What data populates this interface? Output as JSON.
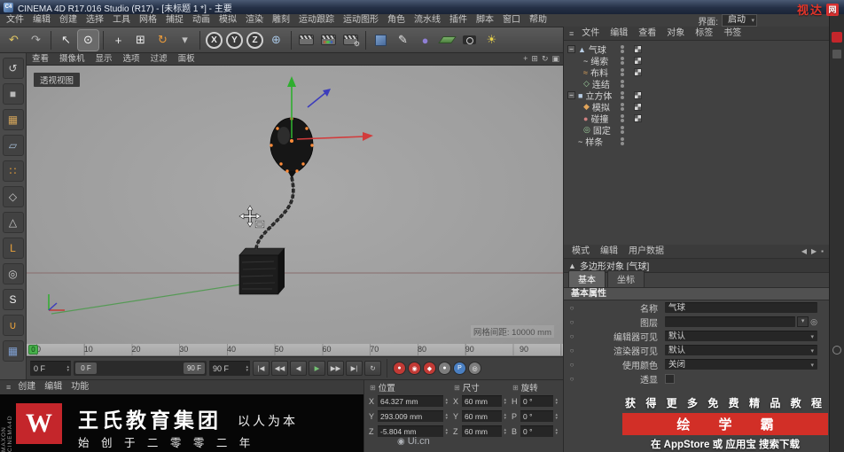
{
  "window": {
    "title": "CINEMA 4D R17.016 Studio (R17) - [未标题 1 *] - 主要",
    "app_badge": "C4",
    "brand": "视达",
    "brand_badge": "网"
  },
  "menubar": {
    "items": [
      "文件",
      "编辑",
      "创建",
      "选择",
      "工具",
      "网格",
      "捕捉",
      "动画",
      "模拟",
      "渲染",
      "雕刻",
      "运动跟踪",
      "运动图形",
      "角色",
      "流水线",
      "插件",
      "脚本",
      "窗口",
      "帮助"
    ],
    "interface_label": "界面:",
    "interface_value": "启动"
  },
  "toolbar": {
    "tools": [
      {
        "name": "undo-icon",
        "glyph": "↶",
        "color": "#dec564"
      },
      {
        "name": "redo-icon",
        "glyph": "↷",
        "color": "#b5b5b5"
      },
      {
        "name": "separator"
      },
      {
        "name": "select-tool-icon",
        "glyph": "↖",
        "color": "#e8e8e8"
      },
      {
        "name": "live-selection-icon",
        "glyph": "⊙",
        "color": "#f2f2f2",
        "active": true
      },
      {
        "name": "separator"
      },
      {
        "name": "move-tool-icon",
        "glyph": "+",
        "color": "#ececec"
      },
      {
        "name": "scale-tool-icon",
        "glyph": "⊞",
        "color": "#ececec"
      },
      {
        "name": "rotate-tool-icon",
        "glyph": "↻",
        "color": "#e89a3c"
      },
      {
        "name": "last-tool-icon",
        "glyph": "▾",
        "color": "#c0c0c0"
      },
      {
        "name": "separator"
      },
      {
        "name": "lock-x-button",
        "label": "X"
      },
      {
        "name": "lock-y-button",
        "label": "Y"
      },
      {
        "name": "lock-z-button",
        "label": "Z"
      },
      {
        "name": "coord-system-icon",
        "glyph": "⊕",
        "color": "#a7c4e2"
      },
      {
        "name": "separator"
      },
      {
        "name": "render-view-icon",
        "type": "clapper"
      },
      {
        "name": "render-picture-icon",
        "type": "clapper-color"
      },
      {
        "name": "render-settings-icon",
        "type": "clapper-gear"
      },
      {
        "name": "separator"
      },
      {
        "name": "primitive-cube-icon",
        "type": "cube"
      },
      {
        "name": "spline-pen-icon",
        "glyph": "✎",
        "color": "#e6e6e6"
      },
      {
        "name": "subdivision-surface-icon",
        "glyph": "●",
        "color": "#8f7fd4"
      },
      {
        "name": "floor-icon",
        "type": "floor"
      },
      {
        "name": "camera-icon",
        "type": "camera"
      },
      {
        "name": "light-icon",
        "glyph": "☀",
        "color": "#e8d24a"
      }
    ]
  },
  "left_toolbar": {
    "tools": [
      {
        "name": "make-editable-icon",
        "glyph": "↺",
        "color": "#cccccc"
      },
      {
        "name": "model-mode-icon",
        "glyph": "■",
        "color": "#b9b9b9"
      },
      {
        "name": "texture-mode-icon",
        "glyph": "▦",
        "color": "#cfa25a"
      },
      {
        "name": "workplane-mode-icon",
        "glyph": "▱",
        "color": "#a5bdd6"
      },
      {
        "name": "points-mode-icon",
        "glyph": "∷",
        "color": "#e8a13c"
      },
      {
        "name": "edges-mode-icon",
        "glyph": "◇",
        "color": "#cccccc"
      },
      {
        "name": "polygons-mode-icon",
        "glyph": "△",
        "color": "#cccccc"
      },
      {
        "name": "axis-mode-icon",
        "glyph": "L",
        "color": "#e8a13c"
      },
      {
        "name": "viewport-solo-icon",
        "glyph": "◎",
        "color": "#cccccc"
      },
      {
        "name": "snap-mode-icon",
        "glyph": "S",
        "color": "#f0f0f0"
      },
      {
        "name": "magnet-icon",
        "glyph": "∪",
        "color": "#e8a13c"
      },
      {
        "name": "workplane-lock-icon",
        "glyph": "▦",
        "color": "#7f9fd0"
      }
    ]
  },
  "viewport": {
    "menu": [
      "查看",
      "摄像机",
      "显示",
      "选项",
      "过滤",
      "面板"
    ],
    "corner_icons": [
      {
        "name": "pan-view-icon",
        "glyph": "+"
      },
      {
        "name": "zoom-view-icon",
        "glyph": "⊞"
      },
      {
        "name": "rotate-view-icon",
        "glyph": "↻"
      },
      {
        "name": "toggle-view-icon",
        "glyph": "▣"
      }
    ],
    "view_label": "透视视图",
    "grid_info": "网格间距: 10000 mm"
  },
  "timeline": {
    "ticks": [
      0,
      10,
      20,
      30,
      40,
      50,
      60,
      70,
      80,
      90
    ],
    "end_label": "90",
    "playhead_frame": "0"
  },
  "transport": {
    "current_frame": "0 F",
    "range_start": "0 F",
    "range_end": "90 F",
    "end_frame": "90 F",
    "buttons": [
      {
        "name": "goto-start-button",
        "glyph": "|◀"
      },
      {
        "name": "prev-key-button",
        "glyph": "◀◀"
      },
      {
        "name": "prev-frame-button",
        "glyph": "◀"
      },
      {
        "name": "play-button",
        "glyph": "▶",
        "color": "#74c274"
      },
      {
        "name": "next-frame-button",
        "glyph": "▶▶"
      },
      {
        "name": "goto-end-button",
        "glyph": "▶|"
      },
      {
        "name": "loop-button",
        "glyph": "↻"
      }
    ],
    "record_buttons": [
      {
        "name": "record-keyframe-button",
        "bg": "#c23a35",
        "glyph": "●"
      },
      {
        "name": "autokey-button",
        "bg": "#c23a35",
        "glyph": "◉"
      },
      {
        "name": "record-position-button",
        "bg": "#c23a35",
        "glyph": "◆"
      },
      {
        "name": "record-parameter-button",
        "bg": "#7d7d7d",
        "glyph": "●"
      },
      {
        "name": "playback-settings-button",
        "bg": "#4a7fc1",
        "glyph": "P"
      },
      {
        "name": "solo-animation-button",
        "bg": "#7d7d7d",
        "glyph": "◎"
      }
    ]
  },
  "materials_menu": {
    "items": [
      "创建",
      "编辑",
      "功能"
    ]
  },
  "coordinates": {
    "groups": [
      {
        "title": "位置",
        "rows": [
          {
            "label": "X",
            "value": "64.327 mm"
          },
          {
            "label": "Y",
            "value": "293.009 mm"
          },
          {
            "label": "Z",
            "value": "-5.804 mm"
          }
        ]
      },
      {
        "title": "尺寸",
        "rows": [
          {
            "label": "X",
            "value": "60 mm"
          },
          {
            "label": "Y",
            "value": "60 mm"
          },
          {
            "label": "Z",
            "value": "60 mm"
          }
        ]
      },
      {
        "title": "旋转",
        "rows": [
          {
            "label": "H",
            "value": "0 °"
          },
          {
            "label": "P",
            "value": "0 °"
          },
          {
            "label": "B",
            "value": "0 °"
          }
        ]
      }
    ]
  },
  "object_manager": {
    "menu": [
      "文件",
      "编辑",
      "查看",
      "对象",
      "标签",
      "书签"
    ],
    "objects": [
      {
        "name": "气球",
        "depth": 0,
        "expanded": true,
        "icon": "polygon",
        "tag": true
      },
      {
        "name": "绳索",
        "depth": 1,
        "icon": "spline",
        "tag": true
      },
      {
        "name": "布料",
        "depth": 1,
        "icon": "cloth",
        "tag": true
      },
      {
        "name": "连结",
        "depth": 1,
        "icon": "connector",
        "tag": false
      },
      {
        "name": "立方体",
        "depth": 0,
        "expanded": true,
        "icon": "cube",
        "tag": true
      },
      {
        "name": "模拟",
        "depth": 1,
        "icon": "simulation",
        "tag": true
      },
      {
        "name": "碰撞",
        "depth": 1,
        "icon": "collider",
        "tag": true
      },
      {
        "name": "固定",
        "depth": 1,
        "icon": "fix",
        "tag": false
      },
      {
        "name": "样条",
        "depth": 0,
        "icon": "spline",
        "tag": false
      }
    ]
  },
  "attributes": {
    "menu": [
      "模式",
      "编辑",
      "用户数据"
    ],
    "corner_icons": [
      {
        "name": "back-icon",
        "glyph": "◀"
      },
      {
        "name": "forward-icon",
        "glyph": "▶"
      },
      {
        "name": "lock-icon",
        "glyph": "▪"
      }
    ],
    "title": "多边形对象 [气球]",
    "tabs": [
      {
        "label": "基本",
        "active": true
      },
      {
        "label": "坐标",
        "active": false
      }
    ],
    "section": "基本属性",
    "rows": [
      {
        "label": "名称",
        "value": "气球",
        "type": "text"
      },
      {
        "label": "图层",
        "value": "",
        "type": "layer"
      },
      {
        "label": "编辑器可见",
        "value": "默认",
        "type": "select"
      },
      {
        "label": "渲染器可见",
        "value": "默认",
        "type": "select"
      },
      {
        "label": "使用颜色",
        "value": "关闭",
        "type": "select"
      },
      {
        "label": "透显",
        "value": "off",
        "type": "checkbox"
      }
    ]
  },
  "banner": {
    "logo_text": "W",
    "title": "王氏教育集团",
    "tagline": "以人为本",
    "subtitle": "始 创 于 二 零 零 二 年",
    "vertical_brand": "MAXON CINEMA4D"
  },
  "ad": {
    "line1": "获 得 更 多 免 费 精 品 教 程",
    "highlight": "绘 学 霸",
    "line3": "在 AppStore 或 应用宝 搜索下载"
  },
  "watermark": "Ui.cn",
  "glyphs": {
    "caret": "▾",
    "spin_up": "▴",
    "spin_down": "▾",
    "menu": "≡",
    "gear": "⚙",
    "group_icon": "⊞",
    "anim_dot": "○",
    "target": "◎",
    "wm_icon": "◉",
    "expand_minus": "−"
  },
  "colors": {
    "axis_x": "#d23c3c",
    "axis_y": "#2fae2f",
    "axis_z": "#3d3dbb",
    "selection_orange": "#ff8c3a",
    "accent_red": "#c4262b"
  }
}
